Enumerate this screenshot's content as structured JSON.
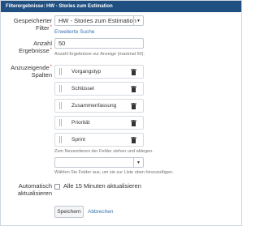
{
  "dialog": {
    "title": "Filterergebnisse: HW - Stories zum Estimation"
  },
  "saved_filter": {
    "label": "Gespeicherter Filter",
    "required_mark": "*",
    "value": "HW - Stories zum Estimation",
    "advanced_link": "Erweiterte Suche"
  },
  "result_count": {
    "label": "Anzahl Ergebnisse",
    "required_mark": "*",
    "value": "50",
    "hint": "Anzahl Ergebnisse zur Anzeige (maximal 50)."
  },
  "columns": {
    "label_line1": "Anzuzeigende",
    "label_line2": "Spalten",
    "required_mark": "*",
    "items": [
      {
        "label": "Vorgangstyp"
      },
      {
        "label": "Schlüssel"
      },
      {
        "label": "Zusammenfassung"
      },
      {
        "label": "Priorität"
      },
      {
        "label": "Sprint"
      }
    ],
    "reorder_hint": "Zum Neusortieren der Felder ziehen und ablegen.",
    "add_select_value": "",
    "add_hint": "Wählen Sie Felder aus, um sie zur Liste oben hinzuzufügen."
  },
  "auto_refresh": {
    "label_line1": "Automatisch",
    "label_line2": "aktualisieren",
    "checkbox_label": "Alle 15 Minuten aktualisieren",
    "checked": false
  },
  "actions": {
    "save_label": "Speichern",
    "cancel_label": "Abbrechen"
  },
  "colors": {
    "titlebar": "#205081",
    "link": "#3572b0",
    "required": "#d04437"
  }
}
